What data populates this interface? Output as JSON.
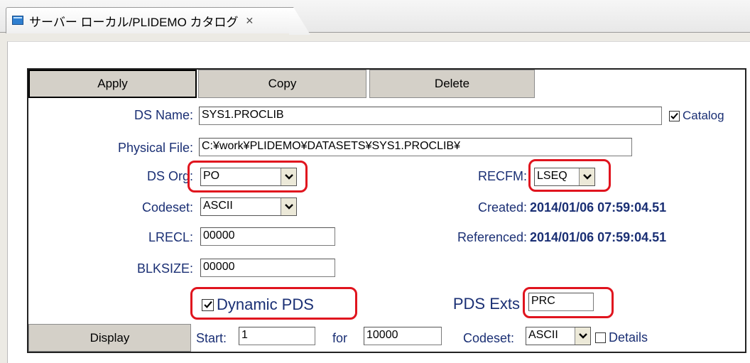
{
  "tab": {
    "title": "サーバー ローカル/PLIDEMO カタログ",
    "close_glyph": "✕"
  },
  "buttons": {
    "apply": "Apply",
    "copy": "Copy",
    "delete": "Delete",
    "display": "Display"
  },
  "ds_name": {
    "label": "DS Name:",
    "value": "SYS1.PROCLIB"
  },
  "catalog": {
    "label": "Catalog",
    "checked": true
  },
  "physical_file": {
    "label": "Physical File:",
    "value": "C:¥work¥PLIDEMO¥DATASETS¥SYS1.PROCLIB¥"
  },
  "ds_org": {
    "label": "DS Org:",
    "value": "PO"
  },
  "recfm": {
    "label": "RECFM:",
    "value": "LSEQ"
  },
  "codeset": {
    "label": "Codeset:",
    "value": "ASCII"
  },
  "created": {
    "label": "Created:",
    "value": "2014/01/06 07:59:04.51"
  },
  "lrecl": {
    "label": "LRECL:",
    "value": "00000"
  },
  "referenced": {
    "label": "Referenced:",
    "value": "2014/01/06 07:59:04.51"
  },
  "blksize": {
    "label": "BLKSIZE:",
    "value": "00000"
  },
  "dynamic_pds": {
    "label": "Dynamic PDS",
    "checked": true
  },
  "pds_exts": {
    "label": "PDS Exts",
    "value": "PRC"
  },
  "display_row": {
    "start_label": "Start:",
    "start_value": "1",
    "for_label": "for",
    "for_value": "10000",
    "codeset_label": "Codeset:",
    "codeset_value": "ASCII",
    "details_label": "Details",
    "details_checked": false
  },
  "colors": {
    "label_text": "#1a2f74",
    "highlight_ring": "#e0141e",
    "button_face": "#d4d0c8"
  }
}
